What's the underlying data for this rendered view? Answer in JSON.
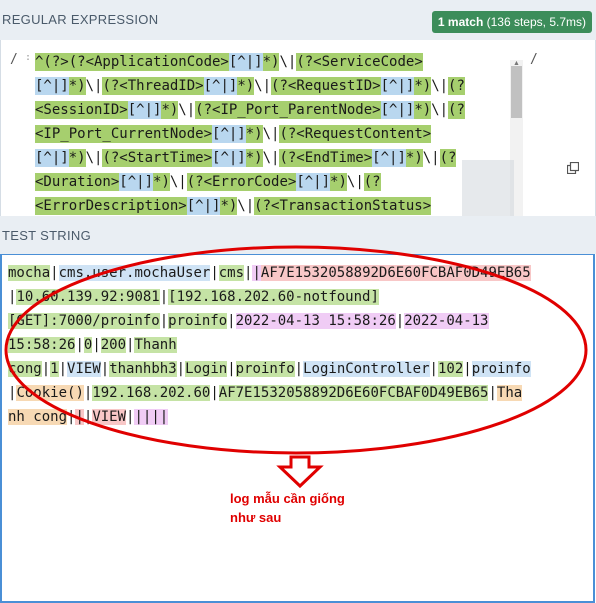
{
  "regex_section": {
    "title": "REGULAR EXPRESSION",
    "match_count": "1 match",
    "match_details": " (136 steps, 5.7ms)",
    "delimiter_left": "/",
    "delimiter_right": "/",
    "flags_hint": ":",
    "lines": [
      [
        [
          "g",
          "^(?>"
        ],
        [
          "g",
          "(?<ApplicationCode>"
        ],
        [
          "b",
          "[^|]"
        ],
        [
          "g",
          "*)"
        ],
        [
          "n",
          "\\|"
        ],
        [
          "g",
          "(?<ServiceCode>"
        ]
      ],
      [
        [
          "b",
          "[^|]"
        ],
        [
          "g",
          "*)"
        ],
        [
          "n",
          "\\|"
        ],
        [
          "g",
          "(?<ThreadID>"
        ],
        [
          "b",
          "[^|]"
        ],
        [
          "g",
          "*)"
        ],
        [
          "n",
          "\\|"
        ],
        [
          "g",
          "(?<RequestID>"
        ],
        [
          "b",
          "[^|]"
        ],
        [
          "g",
          "*)"
        ],
        [
          "n",
          "\\|"
        ],
        [
          "g",
          "(?"
        ]
      ],
      [
        [
          "g",
          "<SessionID>"
        ],
        [
          "b",
          "[^|]"
        ],
        [
          "g",
          "*)"
        ],
        [
          "n",
          "\\|"
        ],
        [
          "g",
          "(?<IP_Port_ParentNode>"
        ],
        [
          "b",
          "[^|]"
        ],
        [
          "g",
          "*)"
        ],
        [
          "n",
          "\\|"
        ],
        [
          "g",
          "(?"
        ]
      ],
      [
        [
          "g",
          "<IP_Port_CurrentNode>"
        ],
        [
          "b",
          "[^|]"
        ],
        [
          "g",
          "*)"
        ],
        [
          "n",
          "\\|"
        ],
        [
          "g",
          "(?<RequestContent>"
        ]
      ],
      [
        [
          "b",
          "[^|]"
        ],
        [
          "g",
          "*)"
        ],
        [
          "n",
          "\\|"
        ],
        [
          "g",
          "(?<StartTime>"
        ],
        [
          "b",
          "[^|]"
        ],
        [
          "g",
          "*)"
        ],
        [
          "n",
          "\\|"
        ],
        [
          "g",
          "(?<EndTime>"
        ],
        [
          "b",
          "[^|]"
        ],
        [
          "g",
          "*)"
        ],
        [
          "n",
          "\\|"
        ],
        [
          "g",
          "(?"
        ]
      ],
      [
        [
          "g",
          "<Duration>"
        ],
        [
          "b",
          "[^|]"
        ],
        [
          "g",
          "*)"
        ],
        [
          "n",
          "\\|"
        ],
        [
          "g",
          "(?<ErrorCode>"
        ],
        [
          "b",
          "[^|]"
        ],
        [
          "g",
          "*)"
        ],
        [
          "n",
          "\\|"
        ],
        [
          "g",
          "(?"
        ]
      ],
      [
        [
          "g",
          "<ErrorDescription>"
        ],
        [
          "b",
          "[^|]"
        ],
        [
          "g",
          "*)"
        ],
        [
          "n",
          "\\|"
        ],
        [
          "g",
          "(?<TransactionStatus>"
        ]
      ]
    ],
    "icons": {
      "copy": "copy-icon",
      "scroll_up": "scroll-up-arrow",
      "scroll_down": "scroll-down-arrow"
    }
  },
  "test_section": {
    "title": "TEST STRING",
    "lines": [
      [
        [
          "g",
          "mocha"
        ],
        [
          "n",
          "|"
        ],
        [
          "b",
          "cms.user.mochaUser"
        ],
        [
          "n",
          "|"
        ],
        [
          "g",
          "cms"
        ],
        [
          "n",
          "|"
        ],
        [
          "p",
          "|"
        ],
        [
          "r",
          "AF7E1532058892D6E60FCBAF0D49EB65"
        ]
      ],
      [
        [
          "n",
          "|"
        ],
        [
          "g",
          "10.60.139.92:9081"
        ],
        [
          "n",
          "|"
        ],
        [
          "g",
          "[192.168.202.60-notfound]"
        ]
      ],
      [
        [
          "g",
          "[GET]:7000/proinfo"
        ],
        [
          "n",
          "|"
        ],
        [
          "g",
          "proinfo"
        ],
        [
          "n",
          "|"
        ],
        [
          "p",
          "2022-04-13 15:58:26"
        ],
        [
          "n",
          "|"
        ],
        [
          "p",
          "2022-04-13 "
        ]
      ],
      [
        [
          "g",
          "15:58:26"
        ],
        [
          "n",
          "|"
        ],
        [
          "g",
          "0"
        ],
        [
          "n",
          "|"
        ],
        [
          "g",
          "200"
        ],
        [
          "n",
          "|"
        ],
        [
          "g",
          "Thanh "
        ]
      ],
      [
        [
          "g",
          "cong"
        ],
        [
          "n",
          "|"
        ],
        [
          "g",
          "1"
        ],
        [
          "n",
          "|"
        ],
        [
          "b",
          "VIEW"
        ],
        [
          "n",
          "|"
        ],
        [
          "g",
          "thanhbh3"
        ],
        [
          "n",
          "|"
        ],
        [
          "g",
          "Login"
        ],
        [
          "n",
          "|"
        ],
        [
          "g",
          "proinfo"
        ],
        [
          "n",
          "|"
        ],
        [
          "b",
          "LoginController"
        ],
        [
          "n",
          "|"
        ],
        [
          "g",
          "102"
        ],
        [
          "n",
          "|"
        ],
        [
          "b",
          "proinfo"
        ]
      ],
      [
        [
          "n",
          "|"
        ],
        [
          "o",
          "Cookie()"
        ],
        [
          "n",
          "|"
        ],
        [
          "g",
          "192.168.202.60"
        ],
        [
          "n",
          "|"
        ],
        [
          "g",
          "AF7E1532058892D6E60FCBAF0D49EB65"
        ],
        [
          "n",
          "|"
        ],
        [
          "o",
          "Tha"
        ]
      ],
      [
        [
          "o",
          "nh cong"
        ],
        [
          "n",
          "|"
        ],
        [
          "r",
          "|"
        ],
        [
          "n",
          "|"
        ],
        [
          "r",
          "VIEW"
        ],
        [
          "n",
          "|"
        ],
        [
          "p",
          "|"
        ],
        [
          "p",
          "|"
        ],
        [
          "p",
          "|"
        ],
        [
          "p",
          "|"
        ]
      ]
    ]
  },
  "annotation": {
    "line1": "log mẫu cần giống",
    "line2": "như sau",
    "arrow_color": "#e00000",
    "oval_color": "#e00000"
  },
  "colors": {
    "badge": "#3c8d5a",
    "group_green": "#a6cf6e",
    "class_blue": "#b9d7ef",
    "border_blue": "#4a8fd6"
  }
}
